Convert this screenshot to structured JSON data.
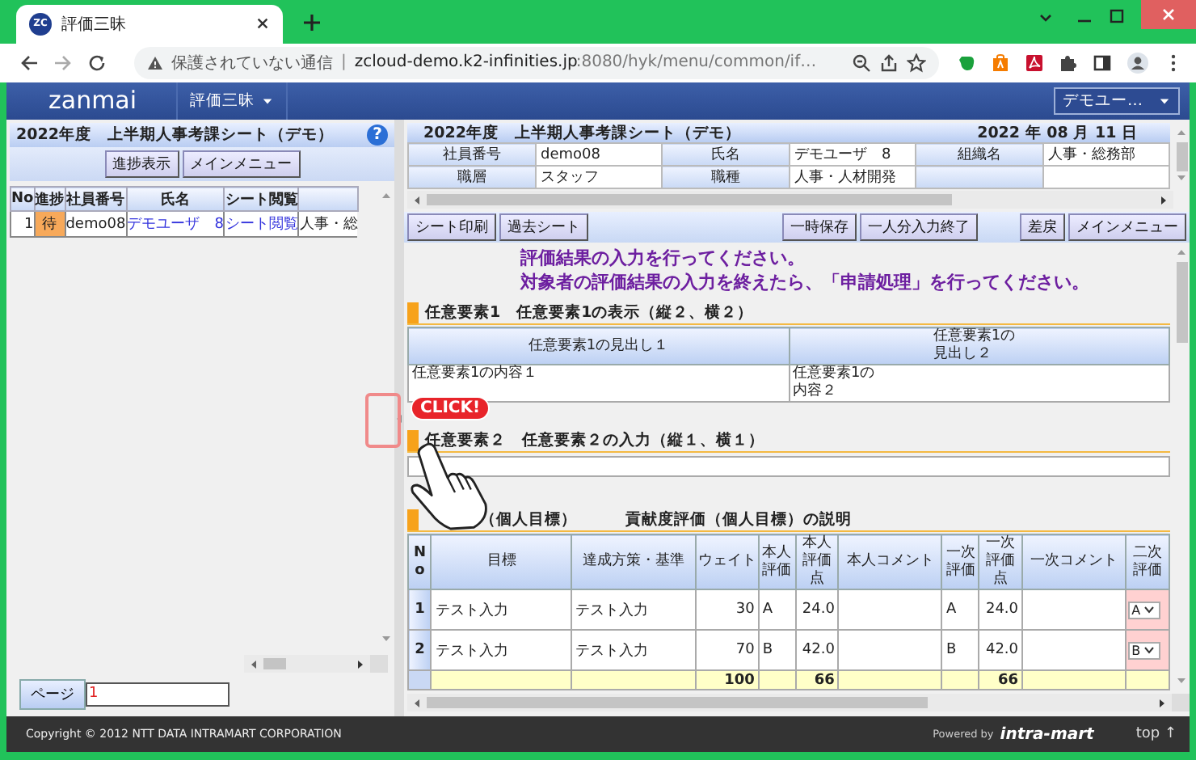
{
  "browser": {
    "tab": {
      "icon_text": "ZC",
      "title": "評価三昧"
    },
    "security_warning": "保護されていない通信",
    "separator": "|",
    "url_host": "zcloud-demo.k2-infinities.jp",
    "url_path": ":8080/hyk/menu/common/if…"
  },
  "app_header": {
    "logo": "zanmai",
    "menu": "評価三昧",
    "user_menu": "デモユー…"
  },
  "left_panel": {
    "title": "2022年度　上半期人事考課シート（デモ）",
    "help": "?",
    "buttons": [
      "進捗表示",
      "メインメニュー"
    ],
    "columns": [
      "No",
      "進捗",
      "社員番号",
      "氏名",
      "シート閲覧"
    ],
    "rows": [
      {
        "no": "1",
        "status": "待",
        "employee_id": "demo08",
        "name": "デモユーザ　8",
        "sheet": "シート閲覧",
        "column_6": "人事・総"
      }
    ],
    "page_label": "ページ",
    "page_value": "1"
  },
  "sheet": {
    "title": "2022年度　上半期人事考課シート（デモ）",
    "date": "2022 年 08 月 11 日",
    "info": [
      [
        {
          "label": "社員番号",
          "value": "demo08"
        },
        {
          "label": "氏名",
          "value": "デモユーザ　8"
        },
        {
          "label": "組織名",
          "value": "人事・総務部"
        }
      ],
      [
        {
          "label": "職層",
          "value": "スタッフ"
        },
        {
          "label": "職種",
          "value": "人事・人材開発"
        }
      ]
    ],
    "toolbar": {
      "left": [
        "シート印刷",
        "過去シート"
      ],
      "center": [
        "一時保存",
        "一人分入力終了"
      ],
      "right": [
        "差戻",
        "メインメニュー"
      ]
    },
    "messages": [
      "評価結果の入力を行ってください。",
      "対象者の評価結果の入力を終えたら、「申請処理」を行ってください。"
    ],
    "section1": {
      "title": "任意要素1　任意要素1の表示（縦２、横２）",
      "headers": [
        "任意要素1の見出し１",
        "任意要素1の見出し２"
      ],
      "cells": [
        "任意要素1の内容１",
        "任意要素1の内容２"
      ]
    },
    "section2": {
      "title": "任意要素２　任意要素２の入力（縦１、横１）"
    },
    "section3": {
      "title": "（個人目標）",
      "description": "貢献度評価（個人目標）の説明"
    },
    "goals": {
      "columns": [
        "No",
        "目標",
        "達成方策・基準",
        "ウェイト",
        "本人評価",
        "本人評価点",
        "本人コメント",
        "一次評価",
        "一次評価点",
        "一次コメント",
        "二次評価"
      ],
      "rows": [
        {
          "no": "1",
          "goal": "テスト入力",
          "method": "テスト入力",
          "weight": "30",
          "self_grade": "A",
          "self_score": "24.0",
          "first_grade": "A",
          "first_score": "24.0",
          "second_grade": "A"
        },
        {
          "no": "2",
          "goal": "テスト入力",
          "method": "テスト入力",
          "weight": "70",
          "self_grade": "B",
          "self_score": "42.0",
          "first_grade": "B",
          "first_score": "42.0",
          "second_grade": "B"
        }
      ],
      "total": {
        "weight": "100",
        "self_score": "66",
        "first_score": "66"
      }
    }
  },
  "callout": {
    "text": "CLICK!"
  },
  "footer": {
    "copyright": "Copyright © 2012 NTT DATA INTRAMART CORPORATION",
    "powered_by": "Powered by",
    "brand": "intra-mart",
    "top": "top ↑"
  }
}
